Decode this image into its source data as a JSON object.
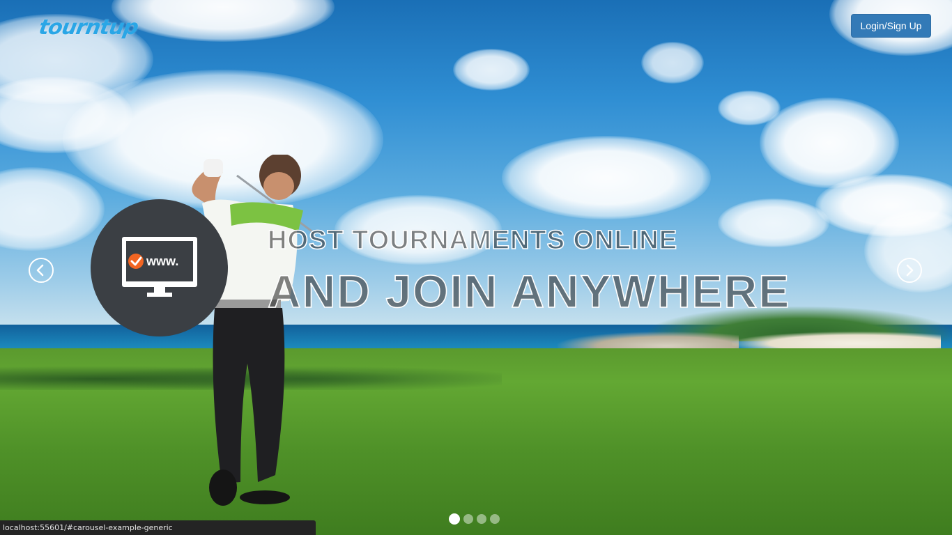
{
  "header": {
    "logo_text": "tourntup",
    "login_label": "Login/Sign Up"
  },
  "carousel": {
    "slide": {
      "headline_line1": "HOST TOURNAMENTS ONLINE",
      "headline_line2": "AND JOIN ANYWHERE",
      "feature_icon": "monitor-www-icon",
      "feature_icon_text": "www."
    },
    "slide_count": 4,
    "active_index": 0,
    "prev_icon": "chevron-left-icon",
    "next_icon": "chevron-right-icon"
  },
  "status_bar": {
    "url": "localhost:55601/#carousel-example-generic"
  },
  "colors": {
    "primary_button": "#337ab7",
    "logo": "#2aa6e6",
    "feature_circle": "#3b3f44",
    "check_badge": "#f26522"
  }
}
